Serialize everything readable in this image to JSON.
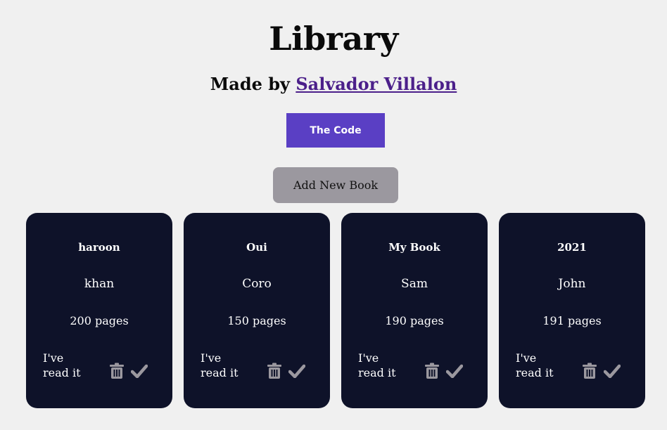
{
  "header": {
    "title": "Library",
    "made_by_prefix": "Made by ",
    "author_link": "Salvador Villalon"
  },
  "buttons": {
    "code_label": "The Code",
    "add_label": "Add New Book"
  },
  "books": [
    {
      "title": "haroon",
      "author": "khan",
      "pages": "200 pages",
      "read_label": "I've read it"
    },
    {
      "title": "Oui",
      "author": "Coro",
      "pages": "150 pages",
      "read_label": "I've read it"
    },
    {
      "title": "My Book",
      "author": "Sam",
      "pages": "190 pages",
      "read_label": "I've read it"
    },
    {
      "title": "2021",
      "author": "John",
      "pages": "191 pages",
      "read_label": "I've read it"
    }
  ],
  "icons": {
    "delete": "trash-icon",
    "read": "check-icon"
  },
  "colors": {
    "background": "#f0f0f0",
    "card": "#0e1229",
    "code_button": "#5a3fc4",
    "add_button": "#9b989f",
    "link": "#4b1f8a",
    "icon": "#9b989f"
  }
}
